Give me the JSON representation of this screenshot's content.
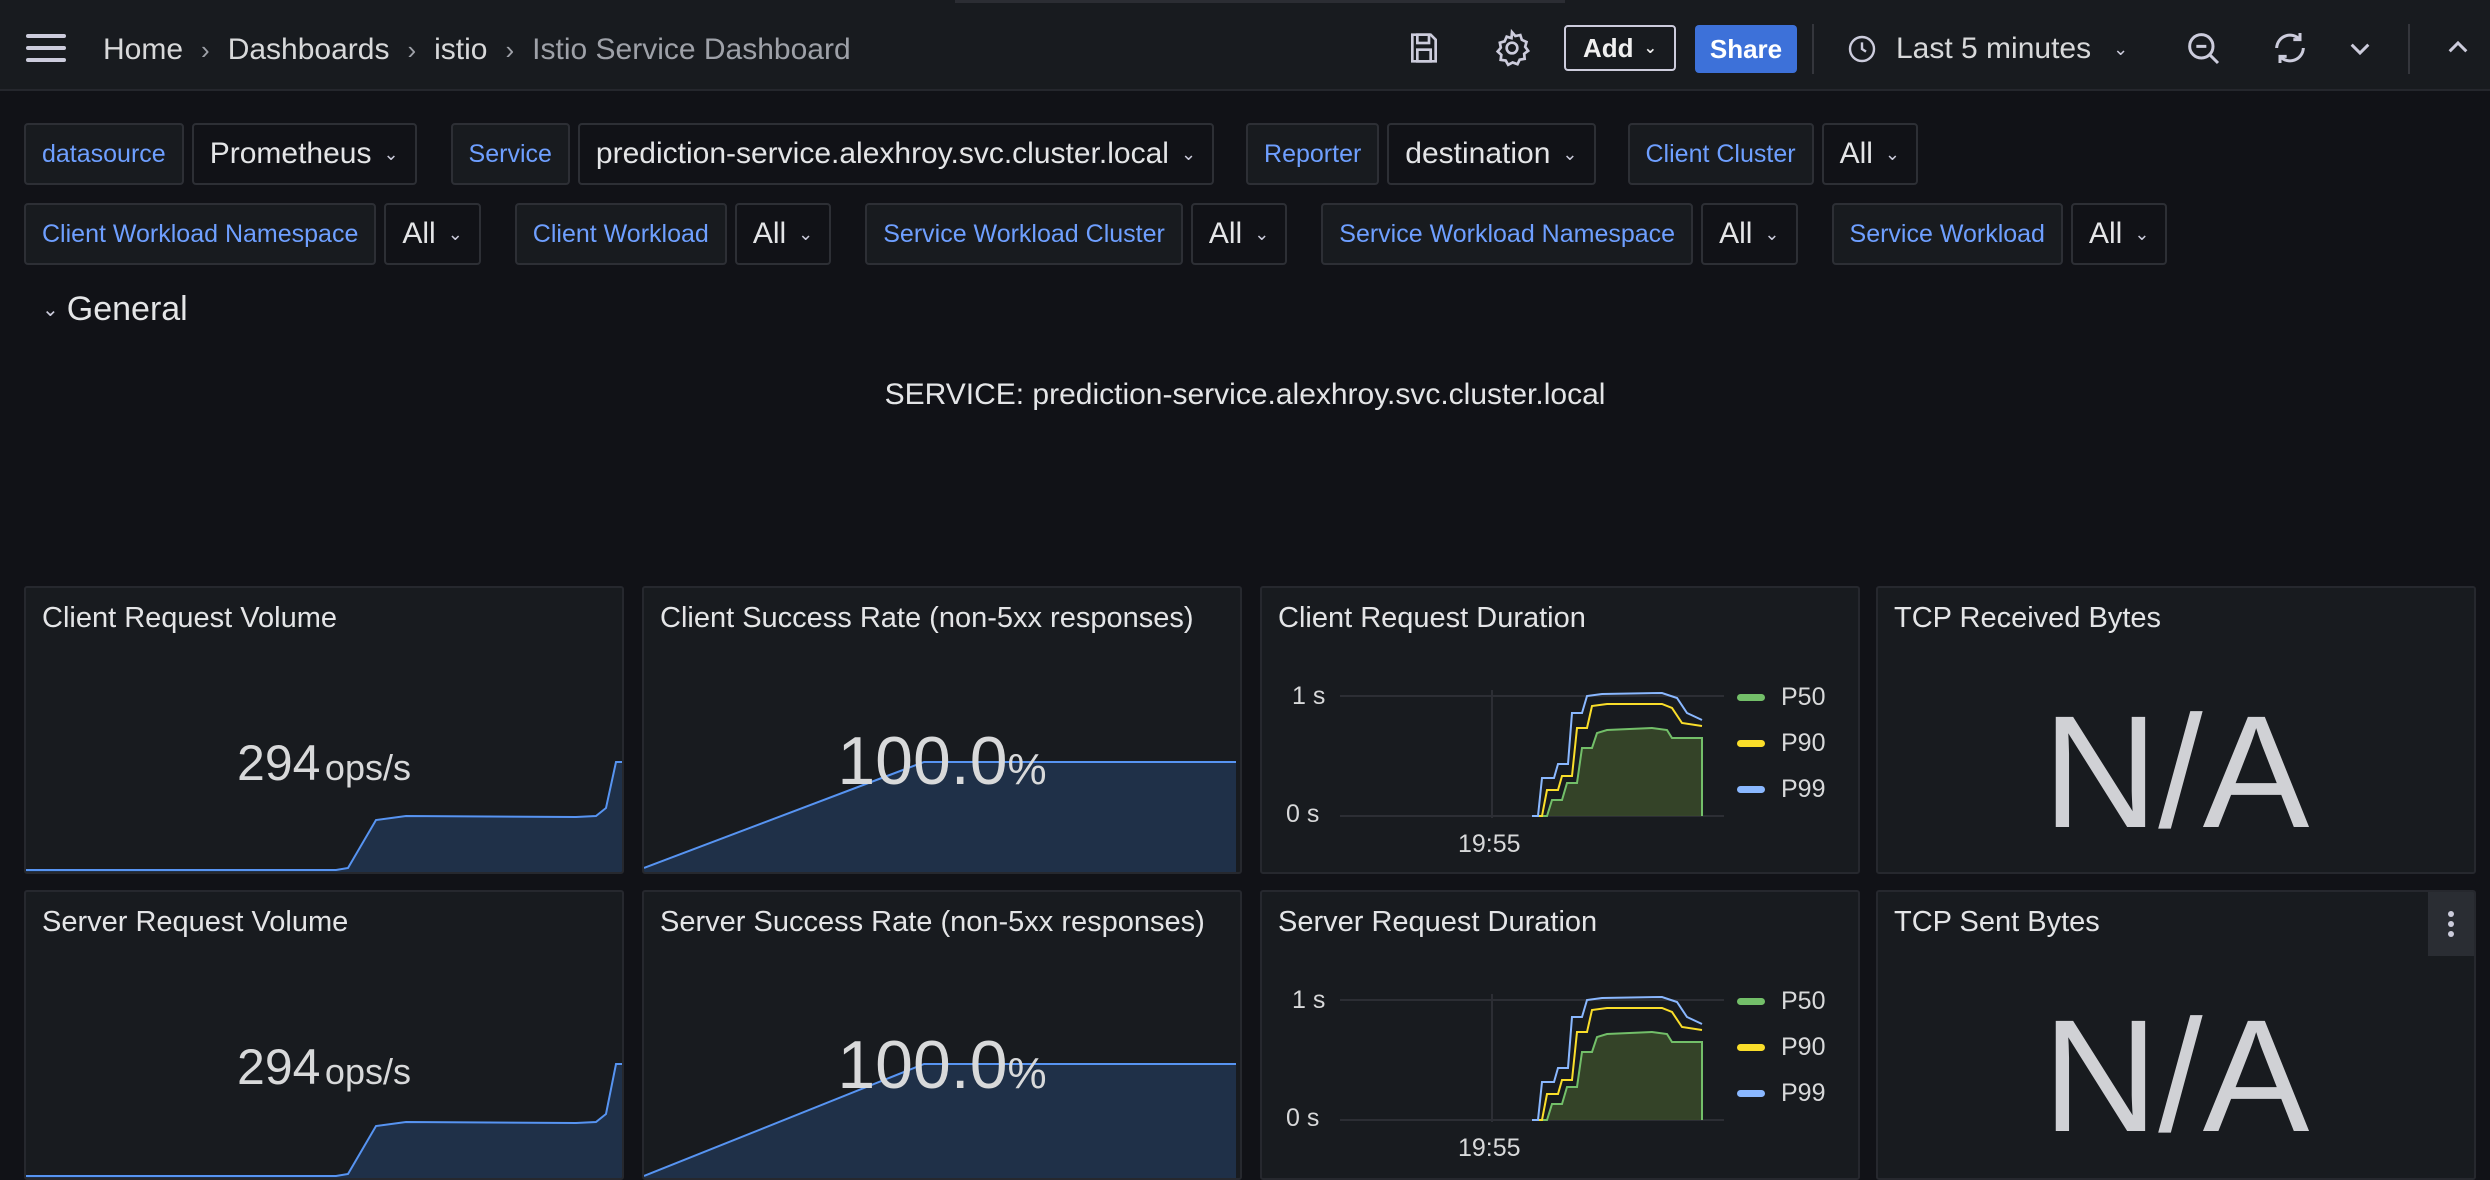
{
  "nav": {
    "breadcrumbs": [
      "Home",
      "Dashboards",
      "istio"
    ],
    "current_page": "Istio Service Dashboard",
    "add_label": "Add",
    "share_label": "Share",
    "time_range": "Last 5 minutes"
  },
  "variables_row1": [
    {
      "label": "datasource",
      "value": "Prometheus"
    },
    {
      "label": "Service",
      "value": "prediction-service.alexhroy.svc.cluster.local"
    },
    {
      "label": "Reporter",
      "value": "destination"
    },
    {
      "label": "Client Cluster",
      "value": "All"
    }
  ],
  "variables_row2": [
    {
      "label": "Client Workload Namespace",
      "value": "All"
    },
    {
      "label": "Client Workload",
      "value": "All"
    },
    {
      "label": "Service Workload Cluster",
      "value": "All"
    },
    {
      "label": "Service Workload Namespace",
      "value": "All"
    },
    {
      "label": "Service Workload",
      "value": "All"
    }
  ],
  "section": {
    "title": "General",
    "service_text": "SERVICE: prediction-service.alexhroy.svc.cluster.local"
  },
  "panels": {
    "client_request_volume": {
      "title": "Client Request Volume",
      "value": "294",
      "unit": "ops/s"
    },
    "client_success_rate": {
      "title": "Client Success Rate (non-5xx responses)",
      "value": "100.0",
      "unit": "%"
    },
    "client_request_duration": {
      "title": "Client Request Duration",
      "y_ticks": [
        "1 s",
        "0 s"
      ],
      "x_tick": "19:55",
      "legend": [
        "P50",
        "P90",
        "P99"
      ]
    },
    "tcp_received_bytes": {
      "title": "TCP Received Bytes",
      "value": "N/A"
    },
    "server_request_volume": {
      "title": "Server Request Volume",
      "value": "294",
      "unit": "ops/s"
    },
    "server_success_rate": {
      "title": "Server Success Rate (non-5xx responses)",
      "value": "100.0",
      "unit": "%"
    },
    "server_request_duration": {
      "title": "Server Request Duration",
      "y_ticks": [
        "1 s",
        "0 s"
      ],
      "x_tick": "19:55",
      "legend": [
        "P50",
        "P90",
        "P99"
      ]
    },
    "tcp_sent_bytes": {
      "title": "TCP Sent Bytes",
      "value": "N/A"
    }
  },
  "colors": {
    "p50": "#73bf69",
    "p90": "#fade2a",
    "p99": "#8ab8ff",
    "accent_blue": "#3d71d9",
    "spark_line": "#5794f2"
  }
}
